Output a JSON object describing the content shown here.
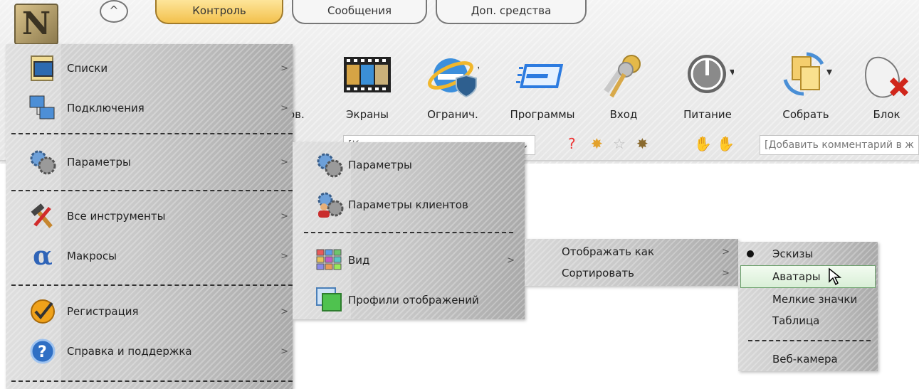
{
  "header": {
    "logo_letter": "N",
    "round_button": "^",
    "tabs": [
      {
        "label": "Контроль",
        "active": true
      },
      {
        "label": "Сообщения",
        "active": false
      },
      {
        "label": "Доп. средства",
        "active": false
      }
    ]
  },
  "toolbar": {
    "partial_label": "ов.",
    "tools": [
      {
        "label": "Экраны",
        "icon": "film-screens-icon"
      },
      {
        "label": "Огранич.",
        "icon": "ie-shield-icon"
      },
      {
        "label": "Программы",
        "icon": "program-window-icon"
      },
      {
        "label": "Вход",
        "icon": "keys-icon"
      },
      {
        "label": "Питание",
        "icon": "power-icon"
      },
      {
        "label": "Собрать",
        "icon": "collect-files-icon"
      },
      {
        "label": "Блок",
        "icon": "blocked-mouse-icon"
      }
    ],
    "comment_placeholder": "[Добавить комментарий в ж",
    "filter_fragment": "[Кр"
  },
  "main_menu": {
    "items": [
      {
        "label": "Списки",
        "icon": "monitor-list-icon",
        "arrow": ">"
      },
      {
        "label": "Подключения",
        "icon": "network-computers-icon",
        "arrow": ">"
      },
      {
        "label": "Параметры",
        "icon": "gears-icon",
        "arrow": ">"
      },
      {
        "label": "Все инструменты",
        "icon": "hammer-tools-icon",
        "arrow": ">"
      },
      {
        "label": "Макросы",
        "icon": "alpha-icon",
        "arrow": ">"
      },
      {
        "label": "Регистрация",
        "icon": "check-circle-icon",
        "arrow": ">"
      },
      {
        "label": "Справка и поддержка",
        "icon": "help-icon",
        "arrow": ">"
      }
    ]
  },
  "params_menu": {
    "items": [
      {
        "label": "Параметры",
        "icon": "gears-icon"
      },
      {
        "label": "Параметры клиентов",
        "icon": "client-gears-icon"
      },
      {
        "label": "Вид",
        "icon": "thumbnails-icon",
        "arrow": ">"
      },
      {
        "label": "Профили отображений",
        "icon": "display-profiles-icon"
      }
    ]
  },
  "view_menu": {
    "items": [
      {
        "label": "Отображать как",
        "arrow": ">"
      },
      {
        "label": "Сортировать",
        "arrow": ">"
      }
    ]
  },
  "display_menu": {
    "items": [
      {
        "label": "Эскизы",
        "selected": true
      },
      {
        "label": "Аватары",
        "highlighted": true
      },
      {
        "label": "Мелкие значки"
      },
      {
        "label": "Таблица"
      },
      {
        "label": "Веб-камера"
      }
    ]
  },
  "colors": {
    "active_tab": "#f3c14d",
    "highlight": "#d9efd7",
    "menu": "#c9c9c9"
  }
}
